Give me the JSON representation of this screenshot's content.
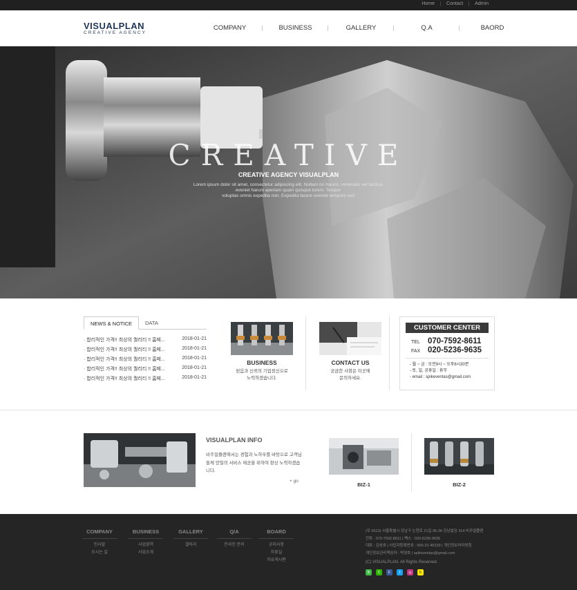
{
  "topbar": {
    "links": [
      "Home",
      "Contact",
      "Admin"
    ]
  },
  "logo": {
    "main": "VISUALPLAN",
    "sub": "CREATIVE AGENCY"
  },
  "nav": [
    "COMPANY",
    "BUSINESS",
    "GALLERY",
    "Q.A",
    "BAORD"
  ],
  "hero": {
    "title": "CREATIVE",
    "subtitle": "CREATIVE AGENCY VISUALPLAN",
    "desc_lines": [
      "Lorem ipsum dolor sit amet, consectetur adipiscing elit. Nullam mi mauris, venenatis vel facilisis",
      "eveniet harum aperiam quam quisque lorem. Tempor",
      "voluptas omnis expedita non. Expedita facere eveniet tempore sed"
    ]
  },
  "news": {
    "tabs": [
      "NEWS & NOTICE",
      "DATA"
    ],
    "items": [
      {
        "title": "합리적인 가격!! 최상의 퀄리티 !! 홈페...",
        "date": "2018-01-21"
      },
      {
        "title": "합리적인 가격!! 최상의 퀄리티 !! 홈페...",
        "date": "2018-01-21"
      },
      {
        "title": "합리적인 가격!! 최상의 퀄리티 !! 홈페...",
        "date": "2018-01-21"
      },
      {
        "title": "합리적인 가격!! 최상의 퀄리티 !! 홈페...",
        "date": "2018-01-21"
      },
      {
        "title": "합리적인 가격!! 최상의 퀄리티 !! 홈페...",
        "date": "2018-01-21"
      }
    ]
  },
  "business_card": {
    "title": "BUSINESS",
    "line1": "믿음과 신뢰의 기업정신으로",
    "line2": "노력하겠습니다."
  },
  "contact_card": {
    "title": "CONTACT US",
    "line1": "궁금한 사항은 이곳에",
    "line2": "문의하세요."
  },
  "customer": {
    "title": "CUSTOMER CENTER",
    "tel_label": "TEL",
    "tel": "070-7592-8611",
    "fax_label": "FAX",
    "fax": "020-5236-9635",
    "hours1": "- 월 ~ 금 : 오전9시 ~ 오후6시30분",
    "hours2": "- 토, 일, 공휴일 : 휴무",
    "email": "- email : spikeventas@gmail.com"
  },
  "info": {
    "title": "VISUALPLAN INFO",
    "text": "비주얼플랜에서는 경험과 노하우를 바탕으로 고객님들께 양질의 서비스 제공을 위하여 항상 노력하겠습니다.",
    "more": "+ go"
  },
  "biz": [
    "BIZ-1",
    "BIZ-2"
  ],
  "footer": {
    "columns": [
      {
        "title": "COMPANY",
        "items": [
          "인사말",
          "오시는 길"
        ]
      },
      {
        "title": "BUSINESS",
        "items": [
          "사업영역",
          "사업소개"
        ]
      },
      {
        "title": "GALLERY",
        "items": [
          "갤러리"
        ]
      },
      {
        "title": "Q/A",
        "items": [
          "온라인 문의"
        ]
      },
      {
        "title": "BOARD",
        "items": [
          "공지사항",
          "자료실",
          "자유게시판"
        ]
      }
    ],
    "address_lines": [
      "(우.5513) 서울특별시 강남구 논현로 21길 96-36 강남빌딩 314 비주얼플랜",
      "전화 : 070-7592-8611  |  팩스 : 020-5236-9635",
      "대표 : 김성호  |  사업자등록번호 : 000-22-45239  |  개인정보처리방침",
      "개인정보관리책임자 : 박영호  |  spikeventas@gmail.com"
    ],
    "copyright": "(C) VISUALPLAN. All Rights Reserved.",
    "social": [
      "B",
      "C",
      "F",
      "t",
      "◎",
      "K"
    ]
  },
  "colors": {
    "brand": "#1e3557",
    "footer_bg": "#252525"
  }
}
